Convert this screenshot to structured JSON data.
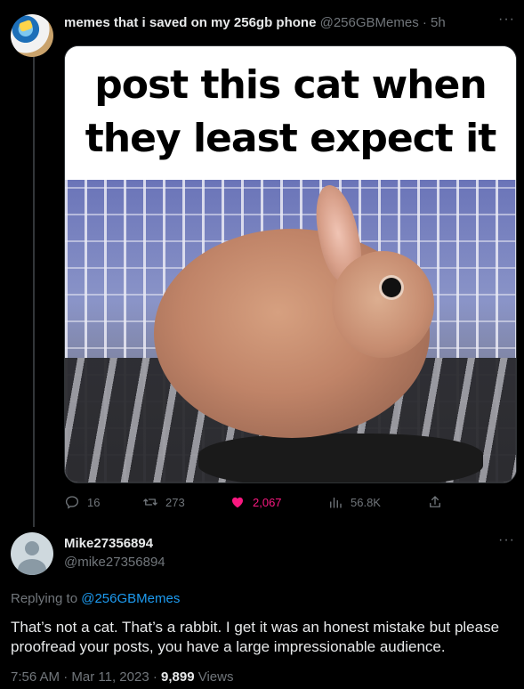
{
  "tweet": {
    "author_name": "memes that i saved on my 256gb phone",
    "author_handle": "@256GBMemes",
    "separator": "·",
    "time_ago": "5h",
    "more": "···",
    "meme_caption_line1": "post this cat when",
    "meme_caption_line2": "they least expect it",
    "actions": {
      "replies": "16",
      "retweets": "273",
      "likes": "2,067",
      "views": "56.8K"
    },
    "colors": {
      "like": "#f91880",
      "link": "#1d9bf0",
      "muted": "#71767b"
    }
  },
  "reply": {
    "author_name": "Mike27356894",
    "author_handle": "@mike27356894",
    "more": "···",
    "replying_to_label": "Replying to",
    "replying_to_handle": "@256GBMemes",
    "text": "That’s not a cat. That’s a rabbit. I get it was an honest mistake but please proofread your posts, you have a large impressionable audience.",
    "time": "7:56 AM",
    "separator": "·",
    "date": "Mar 11, 2023",
    "views_count": "9,899",
    "views_label": "Views"
  },
  "icons": [
    "reply-icon",
    "retweet-icon",
    "like-icon",
    "views-icon",
    "share-icon",
    "more-icon"
  ]
}
